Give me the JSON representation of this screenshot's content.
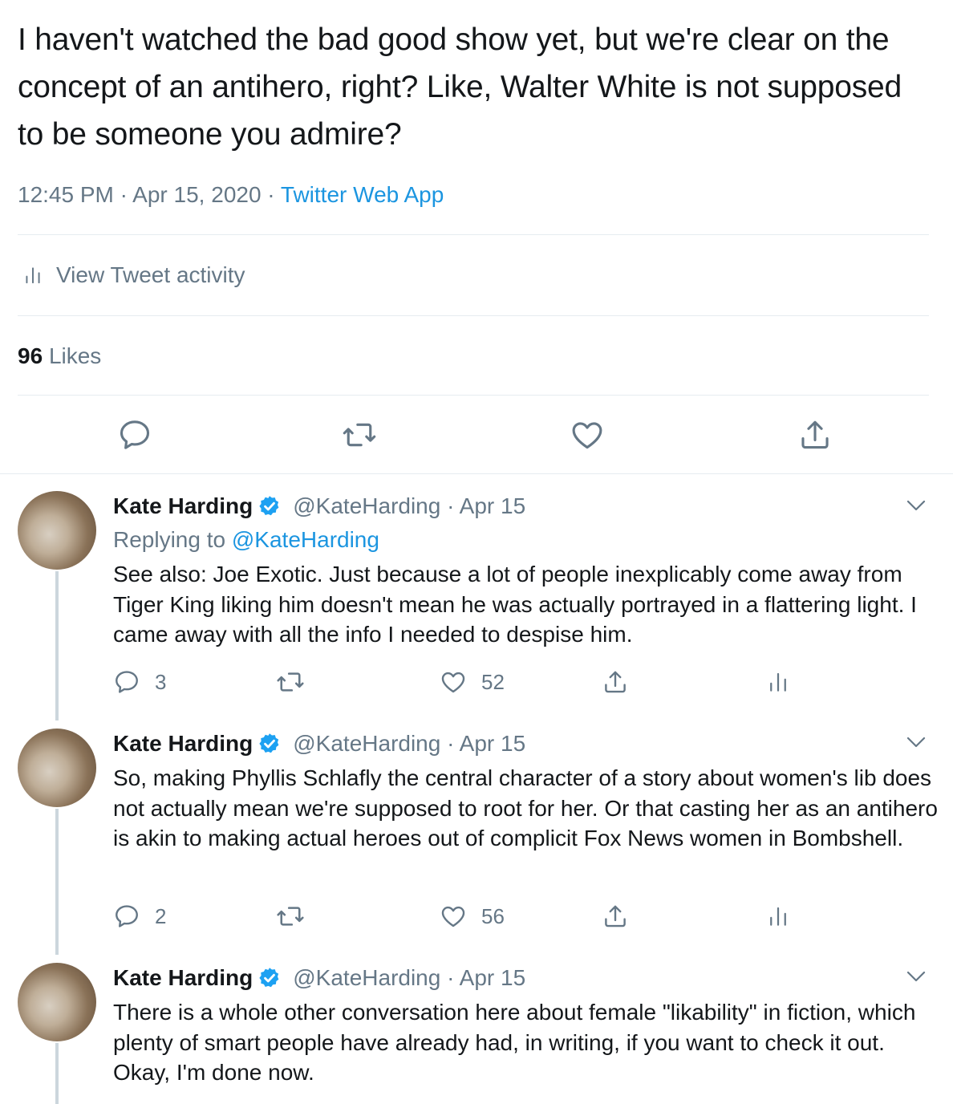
{
  "tweet": {
    "text": "I haven't watched the bad good show yet, but we're clear on the concept of an antihero, right? Like, Walter White is not supposed to be someone you admire?",
    "time": "12:45 PM · Apr 15, 2020 · ",
    "app": "Twitter Web App",
    "activity_label": "View Tweet activity",
    "likes_count": "96",
    "likes_label": "Likes"
  },
  "replies": [
    {
      "name": "Kate Harding",
      "handle": "@KateHarding · Apr 15",
      "replying_prefix": "Replying to ",
      "replying_to": "@KateHarding",
      "text": "See also: Joe Exotic. Just because a lot of people inexplicably come away from Tiger King liking him doesn't mean he was actually portrayed in a flattering light. I came away with all the info I needed to despise him.",
      "reply_count": "3",
      "like_count": "52"
    },
    {
      "name": "Kate Harding",
      "handle": "@KateHarding · Apr 15",
      "text": "So, making Phyllis Schlafly the central character of a story about women's lib does not actually mean we're supposed to root for her. Or that casting her as an antihero is akin to making actual heroes out of complicit Fox News women in Bombshell.",
      "reply_count": "2",
      "like_count": "56"
    },
    {
      "name": "Kate Harding",
      "handle": "@KateHarding · Apr 15",
      "text": "There is a whole other conversation here about female \"likability\" in fiction, which plenty of smart people have already had, in writing, if you want to check it out. Okay, I'm done now."
    }
  ],
  "colors": {
    "text": "#14171a",
    "secondary": "#657786",
    "link": "#1b95e0",
    "divider": "#e6ecf0",
    "thread_line": "#ccd6dd"
  },
  "icons": [
    "reply-icon",
    "retweet-icon",
    "like-icon",
    "share-icon",
    "analytics-icon",
    "verified-icon",
    "chevron-down-icon"
  ]
}
